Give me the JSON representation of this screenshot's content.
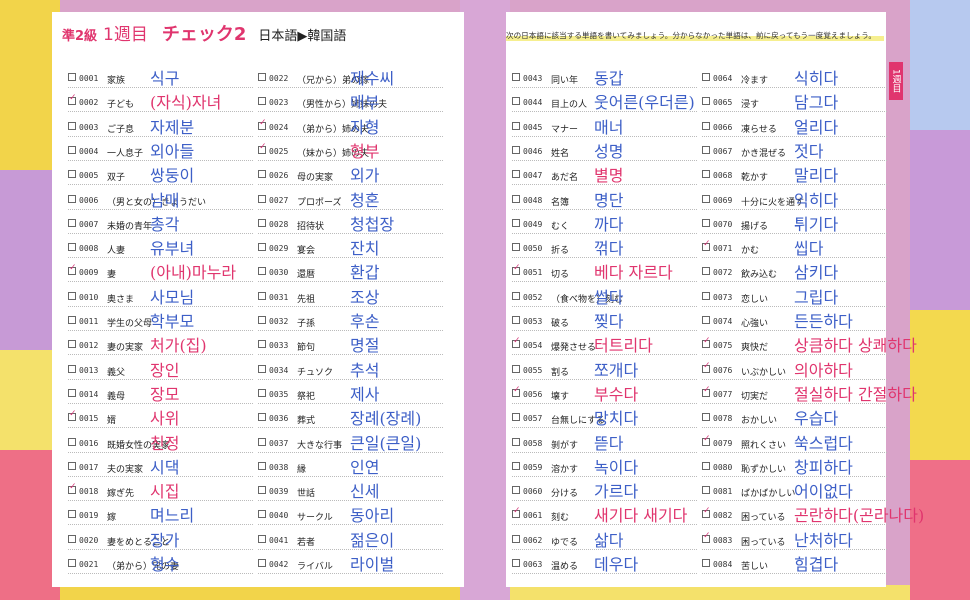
{
  "header": {
    "grade": "準2級",
    "week": "1週目",
    "check": "チェック2",
    "direction": "日本語▶韓国語"
  },
  "instruction": "次の日本語に該当する単語を書いてみましょう。分からなかった単語は、前に戻ってもう一度覚えましょう。",
  "side_tab": "1週目",
  "columns": [
    [
      {
        "num": "0001",
        "jp": "家族",
        "ko": "식구",
        "checked": false,
        "red": false
      },
      {
        "num": "0002",
        "jp": "子ども",
        "ko": "(자식)자녀",
        "checked": true,
        "red": true
      },
      {
        "num": "0003",
        "jp": "ご子息",
        "ko": "자제분",
        "checked": false,
        "red": false
      },
      {
        "num": "0004",
        "jp": "一人息子",
        "ko": "외아들",
        "checked": false,
        "red": false
      },
      {
        "num": "0005",
        "jp": "双子",
        "ko": "쌍둥이",
        "checked": false,
        "red": false
      },
      {
        "num": "0006",
        "jp": "（男と女の）きょうだい",
        "ko": "남매",
        "checked": false,
        "red": false
      },
      {
        "num": "0007",
        "jp": "未婚の青年",
        "ko": "총각",
        "checked": false,
        "red": false
      },
      {
        "num": "0008",
        "jp": "人妻",
        "ko": "유부녀",
        "checked": false,
        "red": false
      },
      {
        "num": "0009",
        "jp": "妻",
        "ko": "(아내)마누라",
        "checked": true,
        "red": true
      },
      {
        "num": "0010",
        "jp": "奥さま",
        "ko": "사모님",
        "checked": false,
        "red": false
      },
      {
        "num": "0011",
        "jp": "学生の父母",
        "ko": "학부모",
        "checked": false,
        "red": false
      },
      {
        "num": "0012",
        "jp": "妻の実家",
        "ko": "처가(집)",
        "checked": false,
        "red": true
      },
      {
        "num": "0013",
        "jp": "義父",
        "ko": "장인",
        "checked": false,
        "red": true
      },
      {
        "num": "0014",
        "jp": "義母",
        "ko": "장모",
        "checked": false,
        "red": true
      },
      {
        "num": "0015",
        "jp": "婿",
        "ko": "사위",
        "checked": true,
        "red": true
      },
      {
        "num": "0016",
        "jp": "既婚女性の実家",
        "ko": "친정",
        "checked": false,
        "red": true
      },
      {
        "num": "0017",
        "jp": "夫の実家",
        "ko": "시댁",
        "checked": false,
        "red": false
      },
      {
        "num": "0018",
        "jp": "嫁ぎ先",
        "ko": "시집",
        "checked": true,
        "red": true
      },
      {
        "num": "0019",
        "jp": "嫁",
        "ko": "며느리",
        "checked": false,
        "red": false
      },
      {
        "num": "0020",
        "jp": "妻をめとること",
        "ko": "장가",
        "checked": false,
        "red": false
      },
      {
        "num": "0021",
        "jp": "（弟から）兄の妻",
        "ko": "형수",
        "checked": false,
        "red": false
      }
    ],
    [
      {
        "num": "0022",
        "jp": "（兄から）弟の嫁",
        "ko": "제수씨",
        "checked": false,
        "red": false
      },
      {
        "num": "0023",
        "jp": "（男性から）姉妹の夫",
        "ko": "매부",
        "checked": false,
        "red": false
      },
      {
        "num": "0024",
        "jp": "（弟から）姉の夫",
        "ko": "자형",
        "checked": true,
        "red": false
      },
      {
        "num": "0025",
        "jp": "（妹から）姉の夫",
        "ko": "형부",
        "checked": true,
        "red": true
      },
      {
        "num": "0026",
        "jp": "母の実家",
        "ko": "외가",
        "checked": false,
        "red": false
      },
      {
        "num": "0027",
        "jp": "プロポーズ",
        "ko": "청혼",
        "checked": false,
        "red": false
      },
      {
        "num": "0028",
        "jp": "招待状",
        "ko": "청첩장",
        "checked": false,
        "red": false
      },
      {
        "num": "0029",
        "jp": "宴会",
        "ko": "잔치",
        "checked": false,
        "red": false
      },
      {
        "num": "0030",
        "jp": "還暦",
        "ko": "환갑",
        "checked": false,
        "red": false
      },
      {
        "num": "0031",
        "jp": "先祖",
        "ko": "조상",
        "checked": false,
        "red": false
      },
      {
        "num": "0032",
        "jp": "子孫",
        "ko": "후손",
        "checked": false,
        "red": false
      },
      {
        "num": "0033",
        "jp": "節句",
        "ko": "명절",
        "checked": false,
        "red": false
      },
      {
        "num": "0034",
        "jp": "チュソク",
        "ko": "추석",
        "checked": false,
        "red": false
      },
      {
        "num": "0035",
        "jp": "祭祀",
        "ko": "제사",
        "checked": false,
        "red": false
      },
      {
        "num": "0036",
        "jp": "葬式",
        "ko": "장례(장례)",
        "checked": false,
        "red": false
      },
      {
        "num": "0037",
        "jp": "大きな行事",
        "ko": "큰일(큰일)",
        "checked": false,
        "red": false
      },
      {
        "num": "0038",
        "jp": "縁",
        "ko": "인연",
        "checked": false,
        "red": false
      },
      {
        "num": "0039",
        "jp": "世話",
        "ko": "신세",
        "checked": false,
        "red": false
      },
      {
        "num": "0040",
        "jp": "サークル",
        "ko": "동아리",
        "checked": false,
        "red": false
      },
      {
        "num": "0041",
        "jp": "若者",
        "ko": "젊은이",
        "checked": false,
        "red": false
      },
      {
        "num": "0042",
        "jp": "ライバル",
        "ko": "라이벌",
        "checked": false,
        "red": false
      }
    ],
    [
      {
        "num": "0043",
        "jp": "同い年",
        "ko": "동갑",
        "checked": false,
        "red": false
      },
      {
        "num": "0044",
        "jp": "目上の人",
        "ko": "웃어른(우더른)",
        "checked": false,
        "red": false
      },
      {
        "num": "0045",
        "jp": "マナー",
        "ko": "매너",
        "checked": false,
        "red": false
      },
      {
        "num": "0046",
        "jp": "姓名",
        "ko": "성명",
        "checked": false,
        "red": false
      },
      {
        "num": "0047",
        "jp": "あだ名",
        "ko": "별명",
        "checked": false,
        "red": true
      },
      {
        "num": "0048",
        "jp": "名簿",
        "ko": "명단",
        "checked": false,
        "red": false
      },
      {
        "num": "0049",
        "jp": "むく",
        "ko": "까다",
        "checked": false,
        "red": false
      },
      {
        "num": "0050",
        "jp": "折る",
        "ko": "꺾다",
        "checked": false,
        "red": false
      },
      {
        "num": "0051",
        "jp": "切る",
        "ko": "베다 자르다",
        "checked": true,
        "red": true
      },
      {
        "num": "0052",
        "jp": "（食べ物を）刻む",
        "ko": "썰다",
        "checked": false,
        "red": false
      },
      {
        "num": "0053",
        "jp": "破る",
        "ko": "찢다",
        "checked": false,
        "red": false
      },
      {
        "num": "0054",
        "jp": "爆発させる",
        "ko": "터트리다",
        "checked": true,
        "red": true
      },
      {
        "num": "0055",
        "jp": "割る",
        "ko": "쪼개다",
        "checked": false,
        "red": false
      },
      {
        "num": "0056",
        "jp": "壊す",
        "ko": "부수다",
        "checked": true,
        "red": true
      },
      {
        "num": "0057",
        "jp": "台無しにする",
        "ko": "망치다",
        "checked": false,
        "red": false
      },
      {
        "num": "0058",
        "jp": "剝がす",
        "ko": "뜯다",
        "checked": false,
        "red": false
      },
      {
        "num": "0059",
        "jp": "溶かす",
        "ko": "녹이다",
        "checked": false,
        "red": false
      },
      {
        "num": "0060",
        "jp": "分ける",
        "ko": "가르다",
        "checked": false,
        "red": false
      },
      {
        "num": "0061",
        "jp": "刻む",
        "ko": "새기다 새기다",
        "checked": true,
        "red": true
      },
      {
        "num": "0062",
        "jp": "ゆでる",
        "ko": "삶다",
        "checked": false,
        "red": false
      },
      {
        "num": "0063",
        "jp": "温める",
        "ko": "데우다",
        "checked": false,
        "red": false
      }
    ],
    [
      {
        "num": "0064",
        "jp": "冷ます",
        "ko": "식히다",
        "checked": false,
        "red": false
      },
      {
        "num": "0065",
        "jp": "浸す",
        "ko": "담그다",
        "checked": false,
        "red": false
      },
      {
        "num": "0066",
        "jp": "凍らせる",
        "ko": "얼리다",
        "checked": false,
        "red": false
      },
      {
        "num": "0067",
        "jp": "かき混ぜる",
        "ko": "젓다",
        "checked": false,
        "red": false
      },
      {
        "num": "0068",
        "jp": "乾かす",
        "ko": "말리다",
        "checked": false,
        "red": false
      },
      {
        "num": "0069",
        "jp": "十分に火を通す",
        "ko": "익히다",
        "checked": false,
        "red": false
      },
      {
        "num": "0070",
        "jp": "揚げる",
        "ko": "튀기다",
        "checked": false,
        "red": false
      },
      {
        "num": "0071",
        "jp": "かむ",
        "ko": "씹다",
        "checked": true,
        "red": false
      },
      {
        "num": "0072",
        "jp": "飲み込む",
        "ko": "삼키다",
        "checked": false,
        "red": false
      },
      {
        "num": "0073",
        "jp": "恋しい",
        "ko": "그립다",
        "checked": false,
        "red": false
      },
      {
        "num": "0074",
        "jp": "心強い",
        "ko": "든든하다",
        "checked": false,
        "red": false
      },
      {
        "num": "0075",
        "jp": "爽快だ",
        "ko": "상큼하다 상쾌하다",
        "checked": true,
        "red": true
      },
      {
        "num": "0076",
        "jp": "いぶかしい",
        "ko": "의아하다",
        "checked": true,
        "red": true
      },
      {
        "num": "0077",
        "jp": "切実だ",
        "ko": "절실하다 간절하다",
        "checked": true,
        "red": true
      },
      {
        "num": "0078",
        "jp": "おかしい",
        "ko": "우습다",
        "checked": false,
        "red": false
      },
      {
        "num": "0079",
        "jp": "照れくさい",
        "ko": "쑥스럽다",
        "checked": true,
        "red": false
      },
      {
        "num": "0080",
        "jp": "恥ずかしい",
        "ko": "창피하다",
        "checked": false,
        "red": false
      },
      {
        "num": "0081",
        "jp": "ばかばかしい",
        "ko": "어이없다",
        "checked": false,
        "red": false
      },
      {
        "num": "0082",
        "jp": "困っている",
        "ko": "곤란하다(곤라나다)",
        "checked": true,
        "red": true
      },
      {
        "num": "0083",
        "jp": "困っている",
        "ko": "난처하다",
        "checked": true,
        "red": false
      },
      {
        "num": "0084",
        "jp": "苦しい",
        "ko": "힘겹다",
        "checked": false,
        "red": false
      }
    ]
  ]
}
